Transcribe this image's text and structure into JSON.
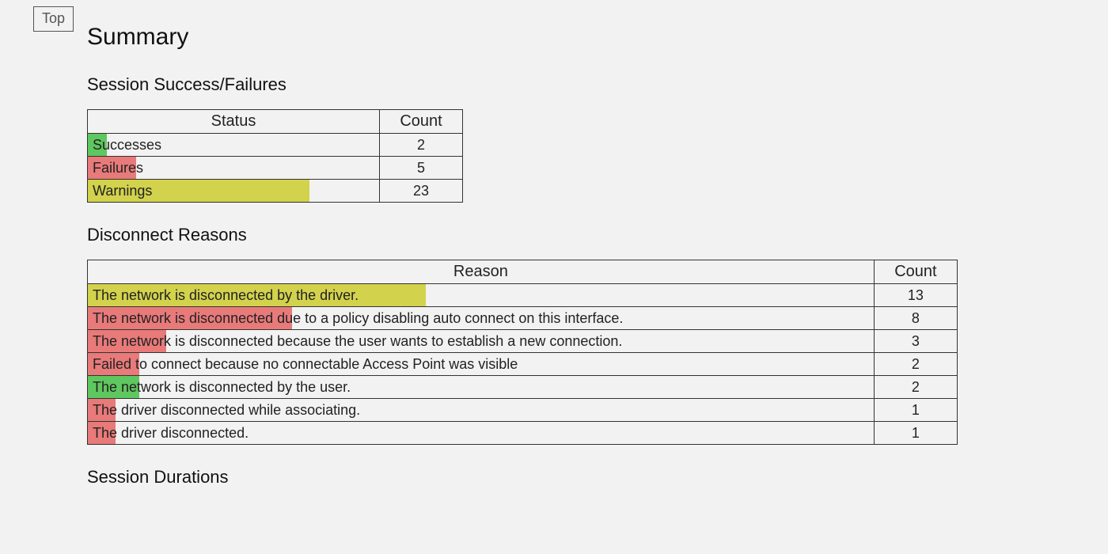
{
  "nav": {
    "top_label": "Top"
  },
  "heading": "Summary",
  "status_section": {
    "heading": "Session Success/Failures",
    "columns": [
      "Status",
      "Count"
    ],
    "rows": [
      {
        "label": "Successes",
        "count": 2,
        "color": "green",
        "bar_pct": 6.5
      },
      {
        "label": "Failures",
        "count": 5,
        "color": "red",
        "bar_pct": 16.5
      },
      {
        "label": "Warnings",
        "count": 23,
        "color": "yellow",
        "bar_pct": 76
      }
    ]
  },
  "disconnect_section": {
    "heading": "Disconnect Reasons",
    "columns": [
      "Reason",
      "Count"
    ],
    "rows": [
      {
        "label": "The network is disconnected by the driver.",
        "count": 13,
        "color": "yellow",
        "bar_pct": 43
      },
      {
        "label": "The network is disconnected due to a policy disabling auto connect on this interface.",
        "count": 8,
        "color": "red",
        "bar_pct": 26
      },
      {
        "label": "The network is disconnected because the user wants to establish a new connection.",
        "count": 3,
        "color": "red",
        "bar_pct": 10
      },
      {
        "label": "Failed to connect because no connectable Access Point was visible",
        "count": 2,
        "color": "red",
        "bar_pct": 6.5
      },
      {
        "label": "The network is disconnected by the user.",
        "count": 2,
        "color": "green",
        "bar_pct": 6.5
      },
      {
        "label": "The driver disconnected while associating.",
        "count": 1,
        "color": "red",
        "bar_pct": 3.5
      },
      {
        "label": "The driver disconnected.",
        "count": 1,
        "color": "red",
        "bar_pct": 3.5
      }
    ]
  },
  "durations_section": {
    "heading": "Session Durations"
  },
  "chart_data": [
    {
      "type": "bar",
      "title": "Session Success/Failures",
      "categories": [
        "Successes",
        "Failures",
        "Warnings"
      ],
      "values": [
        2,
        5,
        23
      ],
      "xlabel": "Status",
      "ylabel": "Count"
    },
    {
      "type": "bar",
      "title": "Disconnect Reasons",
      "categories": [
        "The network is disconnected by the driver.",
        "The network is disconnected due to a policy disabling auto connect on this interface.",
        "The network is disconnected because the user wants to establish a new connection.",
        "Failed to connect because no connectable Access Point was visible",
        "The network is disconnected by the user.",
        "The driver disconnected while associating.",
        "The driver disconnected."
      ],
      "values": [
        13,
        8,
        3,
        2,
        2,
        1,
        1
      ],
      "xlabel": "Reason",
      "ylabel": "Count"
    }
  ]
}
